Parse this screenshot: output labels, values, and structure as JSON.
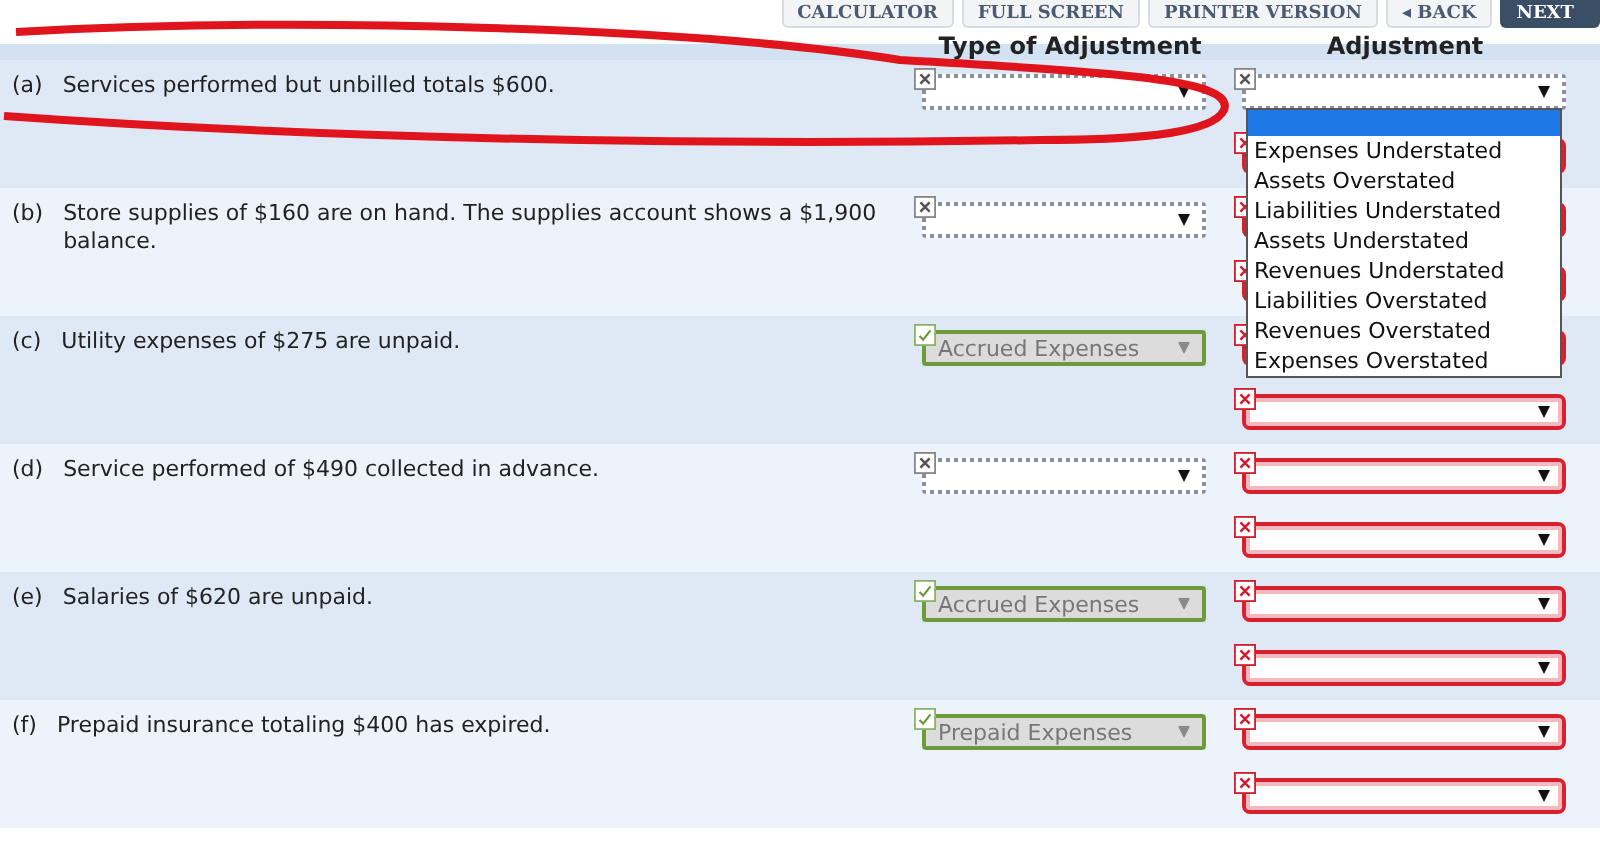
{
  "toolbar": [
    {
      "label": "CALCULATOR",
      "kind": "plain"
    },
    {
      "label": "FULL SCREEN",
      "kind": "plain"
    },
    {
      "label": "PRINTER VERSION",
      "kind": "plain"
    },
    {
      "label": "◂ BACK",
      "kind": "plain"
    },
    {
      "label": "NEXT",
      "kind": "primary"
    }
  ],
  "columns": [
    "Type of Adjustment",
    "Adjustment"
  ],
  "rows": [
    {
      "letter": "(a)",
      "text": "Services performed but unbilled totals $600.",
      "type": {
        "graded": false
      },
      "adjustments": [
        {
          "graded": false,
          "open": true,
          "options": [
            "Expenses Understated",
            "Assets Overstated",
            "Liabilities Understated",
            "Assets Understated",
            "Revenues Understated",
            "Liabilities Overstated",
            "Revenues Overstated",
            "Expenses Overstated"
          ]
        },
        {
          "graded": true,
          "correct": false
        }
      ]
    },
    {
      "letter": "(b)",
      "text": "Store supplies of $160 are on hand. The supplies account shows a $1,900 balance.",
      "type": {
        "graded": false
      },
      "adjustments": [
        {
          "graded": true,
          "correct": false
        },
        {
          "graded": true,
          "correct": false
        }
      ]
    },
    {
      "letter": "(c)",
      "text": "Utility expenses of $275 are unpaid.",
      "type": {
        "graded": true,
        "correct": true,
        "value": "Accrued Expenses"
      },
      "adjustments": [
        {
          "graded": true,
          "correct": false
        },
        {
          "graded": true,
          "correct": false
        }
      ]
    },
    {
      "letter": "(d)",
      "text": "Service performed of $490 collected in advance.",
      "type": {
        "graded": false
      },
      "adjustments": [
        {
          "graded": true,
          "correct": false
        },
        {
          "graded": true,
          "correct": false
        }
      ]
    },
    {
      "letter": "(e)",
      "text": "Salaries of $620 are unpaid.",
      "type": {
        "graded": true,
        "correct": true,
        "value": "Accrued Expenses"
      },
      "adjustments": [
        {
          "graded": true,
          "correct": false
        },
        {
          "graded": true,
          "correct": false
        }
      ]
    },
    {
      "letter": "(f)",
      "text": "Prepaid insurance totaling $400 has expired.",
      "type": {
        "graded": true,
        "correct": true,
        "value": "Prepaid Expenses"
      },
      "adjustments": [
        {
          "graded": true,
          "correct": false
        },
        {
          "graded": true,
          "correct": false
        }
      ]
    }
  ]
}
